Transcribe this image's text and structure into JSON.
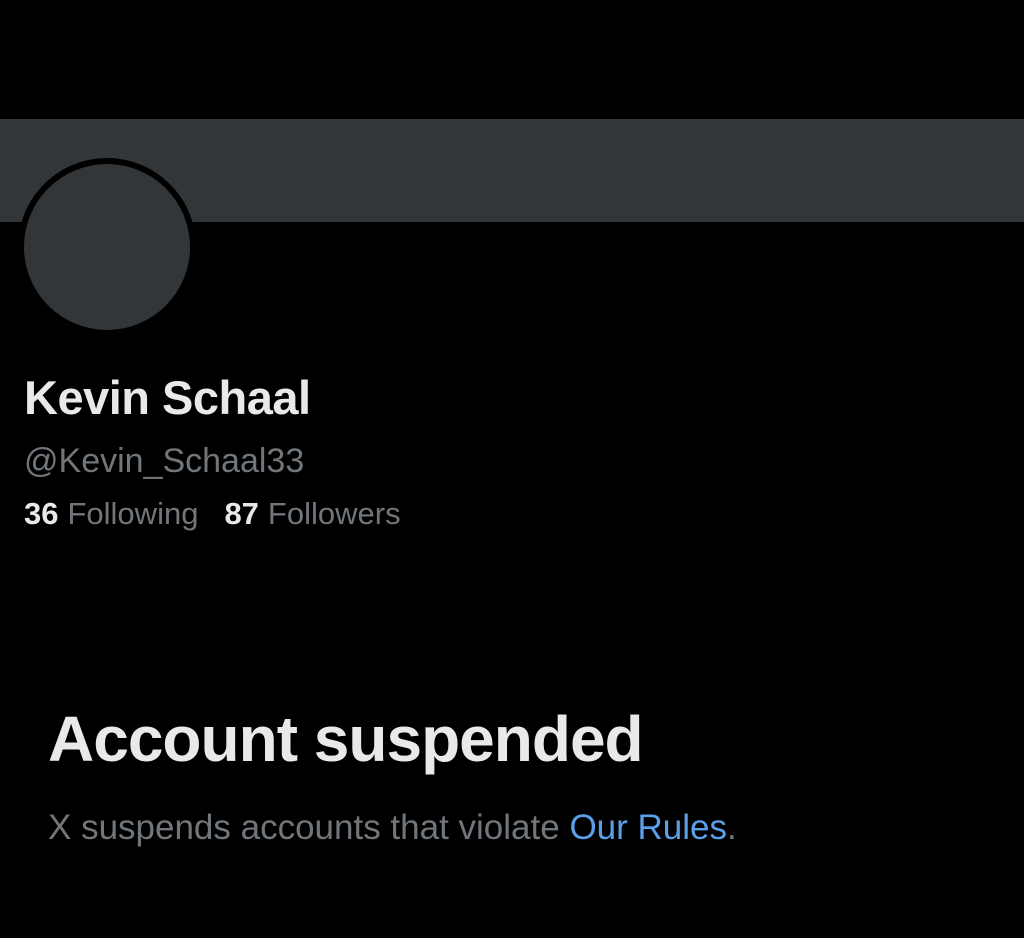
{
  "profile": {
    "display_name": "Kevin Schaal",
    "handle": "@Kevin_Schaal33",
    "following_count": "36",
    "following_label": "Following",
    "followers_count": "87",
    "followers_label": "Followers"
  },
  "suspension": {
    "title": "Account suspended",
    "message": "X suspends accounts that violate ",
    "rules_link": "Our Rules",
    "message_end": "."
  },
  "colors": {
    "background": "#000000",
    "banner": "#333639",
    "primary_text": "#e7e9ea",
    "secondary_text": "#71767b",
    "link": "#5b9fe8"
  }
}
